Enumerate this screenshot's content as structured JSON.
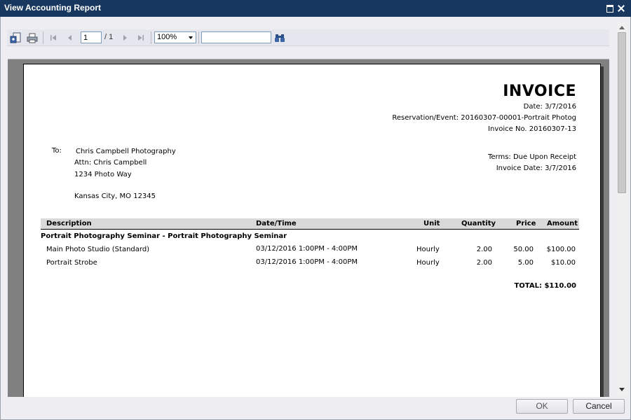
{
  "window": {
    "title": "View Accounting Report"
  },
  "toolbar": {
    "icons": [
      "export-icon",
      "print-icon",
      "first-page-icon",
      "prev-page-icon",
      "next-page-icon",
      "last-page-icon",
      "binoculars-icon"
    ],
    "page_value": "1",
    "page_total": "/ 1",
    "zoom": "100%",
    "search_value": ""
  },
  "invoice": {
    "title": "INVOICE",
    "date": "Date: 3/7/2016",
    "reservation": "Reservation/Event: 20160307-00001-Portrait Photog",
    "invoice_no": "Invoice No. 20160307-13",
    "to_label": "To:",
    "to_name": "Chris Campbell Photography",
    "attn": "Attn: Chris Campbell",
    "address1": "1234 Photo Way",
    "city": "Kansas City, MO  12345",
    "terms": "Terms: Due Upon Receipt",
    "invoice_date": "Invoice Date: 3/7/2016",
    "columns": {
      "description": "Description",
      "datetime": "Date/Time",
      "unit": "Unit",
      "quantity": "Quantity",
      "price": "Price",
      "amount": "Amount"
    },
    "group": "Portrait Photography Seminar - Portrait Photography Seminar",
    "rows": [
      {
        "description": "Main Photo Studio (Standard)",
        "datetime": "03/12/2016  1:00PM -  4:00PM",
        "unit": "Hourly",
        "quantity": "2.00",
        "price": "50.00",
        "amount": "$100.00"
      },
      {
        "description": "Portrait Strobe",
        "datetime": "03/12/2016  1:00PM -  4:00PM",
        "unit": "Hourly",
        "quantity": "2.00",
        "price": "5.00",
        "amount": "$10.00"
      }
    ],
    "total": "TOTAL: $110.00"
  },
  "footer": {
    "ok_label": "OK",
    "cancel_label": "Cancel"
  }
}
